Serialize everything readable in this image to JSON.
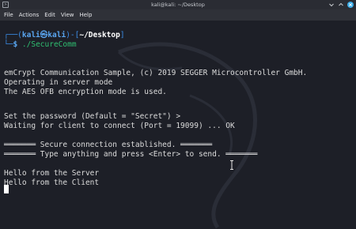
{
  "window": {
    "title": "kali@kali: ~/Desktop"
  },
  "menubar": {
    "items": [
      "File",
      "Actions",
      "Edit",
      "View",
      "Help"
    ]
  },
  "terminal": {
    "prompt": {
      "top_prefix": "┌──(",
      "user": "kali",
      "at_symbol": "㉿",
      "host": "kali",
      "bracket_mid": ")-[",
      "path": "~/Desktop",
      "bracket_end": "]",
      "bottom_prefix": "└─",
      "dollar": "$ ",
      "command": "./SecureComm"
    },
    "lines": [
      "emCrypt Communication Sample, (c) 2019 SEGGER Microcontroller GmbH.",
      "Operating in server mode",
      "The AES OFB encryption mode is used.",
      "Set the password (Default = \"Secret\") >",
      "Waiting for client to connect (Port = 19099) ... OK",
      "═══════ Secure connection established. ═══════",
      "═══════ Type anything and press <Enter> to send. ═══════",
      "Hello from the Server",
      "Hello from the Client"
    ]
  }
}
